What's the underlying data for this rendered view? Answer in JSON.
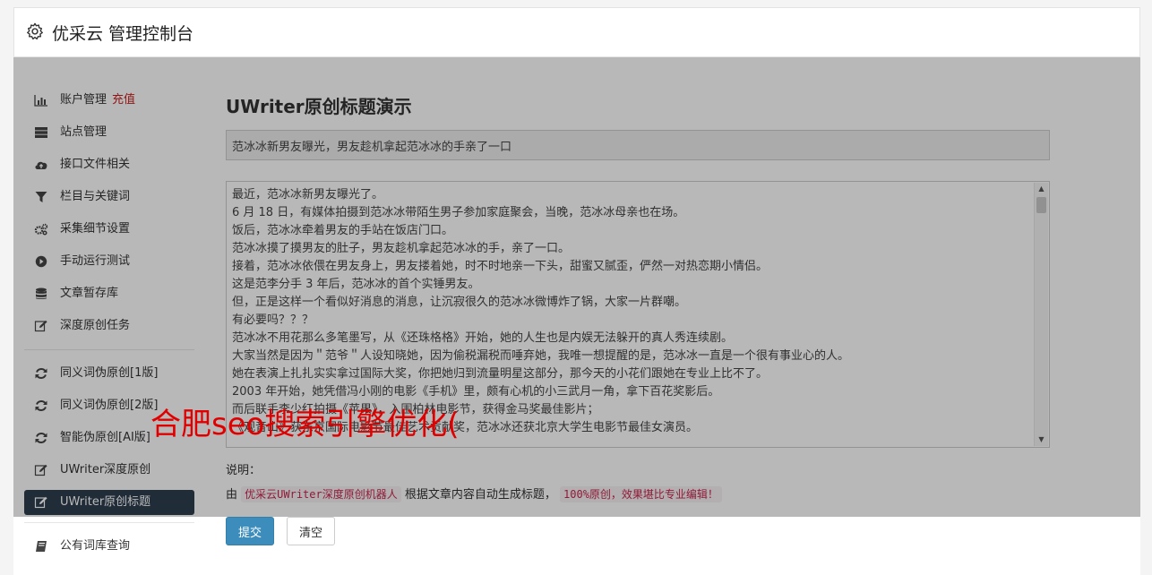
{
  "header": {
    "icon": "gear-icon",
    "title": "优采云 管理控制台"
  },
  "sidebar": {
    "items": [
      {
        "icon": "bar-chart-icon",
        "label": "账户管理",
        "accent": "充值"
      },
      {
        "icon": "server-icon",
        "label": "站点管理"
      },
      {
        "icon": "cloud-upload-icon",
        "label": "接口文件相关"
      },
      {
        "icon": "filter-icon",
        "label": "栏目与关键词"
      },
      {
        "icon": "gears-icon",
        "label": "采集细节设置"
      },
      {
        "icon": "play-circle-icon",
        "label": "手动运行测试"
      },
      {
        "icon": "database-icon",
        "label": "文章暂存库"
      },
      {
        "icon": "edit-icon",
        "label": "深度原创任务"
      },
      {
        "icon": "refresh-icon",
        "label": "同义词伪原创[1版]"
      },
      {
        "icon": "refresh-icon",
        "label": "同义词伪原创[2版]"
      },
      {
        "icon": "refresh-icon",
        "label": "智能伪原创[AI版]"
      },
      {
        "icon": "edit-icon",
        "label": "UWriter深度原创"
      },
      {
        "icon": "edit-icon",
        "label": "UWriter原创标题"
      },
      {
        "icon": "book-icon",
        "label": "公有词库查询"
      }
    ]
  },
  "content": {
    "heading": "UWriter原创标题演示",
    "title_value": "范冰冰新男友曝光，男友趁机拿起范冰冰的手亲了一口",
    "article_lines": [
      "最近，范冰冰新男友曝光了。",
      "6 月 18 日，有媒体拍摄到范冰冰带陌生男子参加家庭聚会，当晚，范冰冰母亲也在场。",
      "饭后，范冰冰牵着男友的手站在饭店门口。",
      "范冰冰摸了摸男友的肚子，男友趁机拿起范冰冰的手，亲了一口。",
      "接着，范冰冰依偎在男友身上，男友搂着她，时不时地亲一下头，甜蜜又腻歪，俨然一对热恋期小情侣。",
      "这是范李分手 3 年后，范冰冰的首个实锤男友。",
      "但，正是这样一个看似好消息的消息，让沉寂很久的范冰冰微博炸了锅，大家一片群嘲。",
      "有必要吗？？？",
      "范冰冰不用花那么多笔墨写，从《还珠格格》开始，她的人生也是内娱无法躲开的真人秀连续剧。",
      "大家当然是因为＂范爷＂人设知晓她，因为偷税漏税而唾弃她，我唯一想提醒的是，范冰冰一直是一个很有事业心的人。",
      "她在表演上扎扎实实拿过国际大奖，你把她归到流量明星这部分，那今天的小花们跟她在专业上比不了。",
      "2003 年开始，她凭借冯小刚的电影《手机》里，颇有心机的小三武月一角，拿下百花奖影后。",
      "而后联手李少红拍摄《苹果》，入围柏林电影节，获得金马奖最佳影片；",
      "《观音山》获东京国际电影节最佳艺术贡献奖，范冰冰还获北京大学生电影节最佳女演员。"
    ],
    "notes_label": "说明：",
    "notes_prefix": "由",
    "notes_code1": "优采云UWriter深度原创机器人",
    "notes_middle": "根据文章内容自动生成标题，",
    "notes_code2": "100%原创，效果堪比专业编辑！",
    "submit_label": "提交",
    "clear_label": "清空"
  },
  "watermark": "合肥seo搜索引擎优化("
}
